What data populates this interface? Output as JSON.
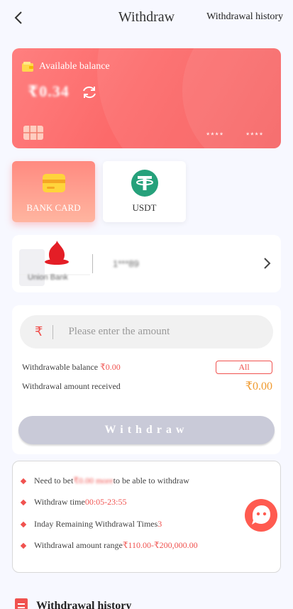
{
  "header": {
    "title": "Withdraw",
    "history_link": "Withdrawal history"
  },
  "balance_card": {
    "label": "Available balance",
    "amount": "₹0.34",
    "card_mask_1": "****",
    "card_mask_2": "****"
  },
  "methods": [
    {
      "label": "BANK CARD",
      "selected": true
    },
    {
      "label": "USDT",
      "selected": false
    }
  ],
  "bank": {
    "name": "Union Bank",
    "account": "1***89"
  },
  "form": {
    "currency_symbol": "₹",
    "amount_placeholder": "Please enter the amount",
    "withdrawable_label": "Withdrawable balance ",
    "withdrawable_value": "₹0.00",
    "all_label": "All",
    "received_label": "Withdrawal amount received",
    "received_value": "₹0.00",
    "withdraw_button": "Withdraw"
  },
  "rules": {
    "bet_prefix": "Need to bet ",
    "bet_amount": "₹0.00 more ",
    "bet_suffix": "to be able to withdraw",
    "time_label": "Withdraw time ",
    "time_value": "00:05-23:55",
    "remaining_label": "Inday Remaining Withdrawal Times",
    "remaining_value": "3",
    "range_label": "Withdrawal amount range ",
    "range_value": "₹110.00-₹200,000.00"
  },
  "history": {
    "title": "Withdrawal history"
  },
  "colors": {
    "accent": "#f0524f",
    "orange": "#f09a2e",
    "card_gradient_start": "#ff7f7f",
    "card_gradient_end": "#f65a5a",
    "usdt_green": "#26a17b"
  }
}
